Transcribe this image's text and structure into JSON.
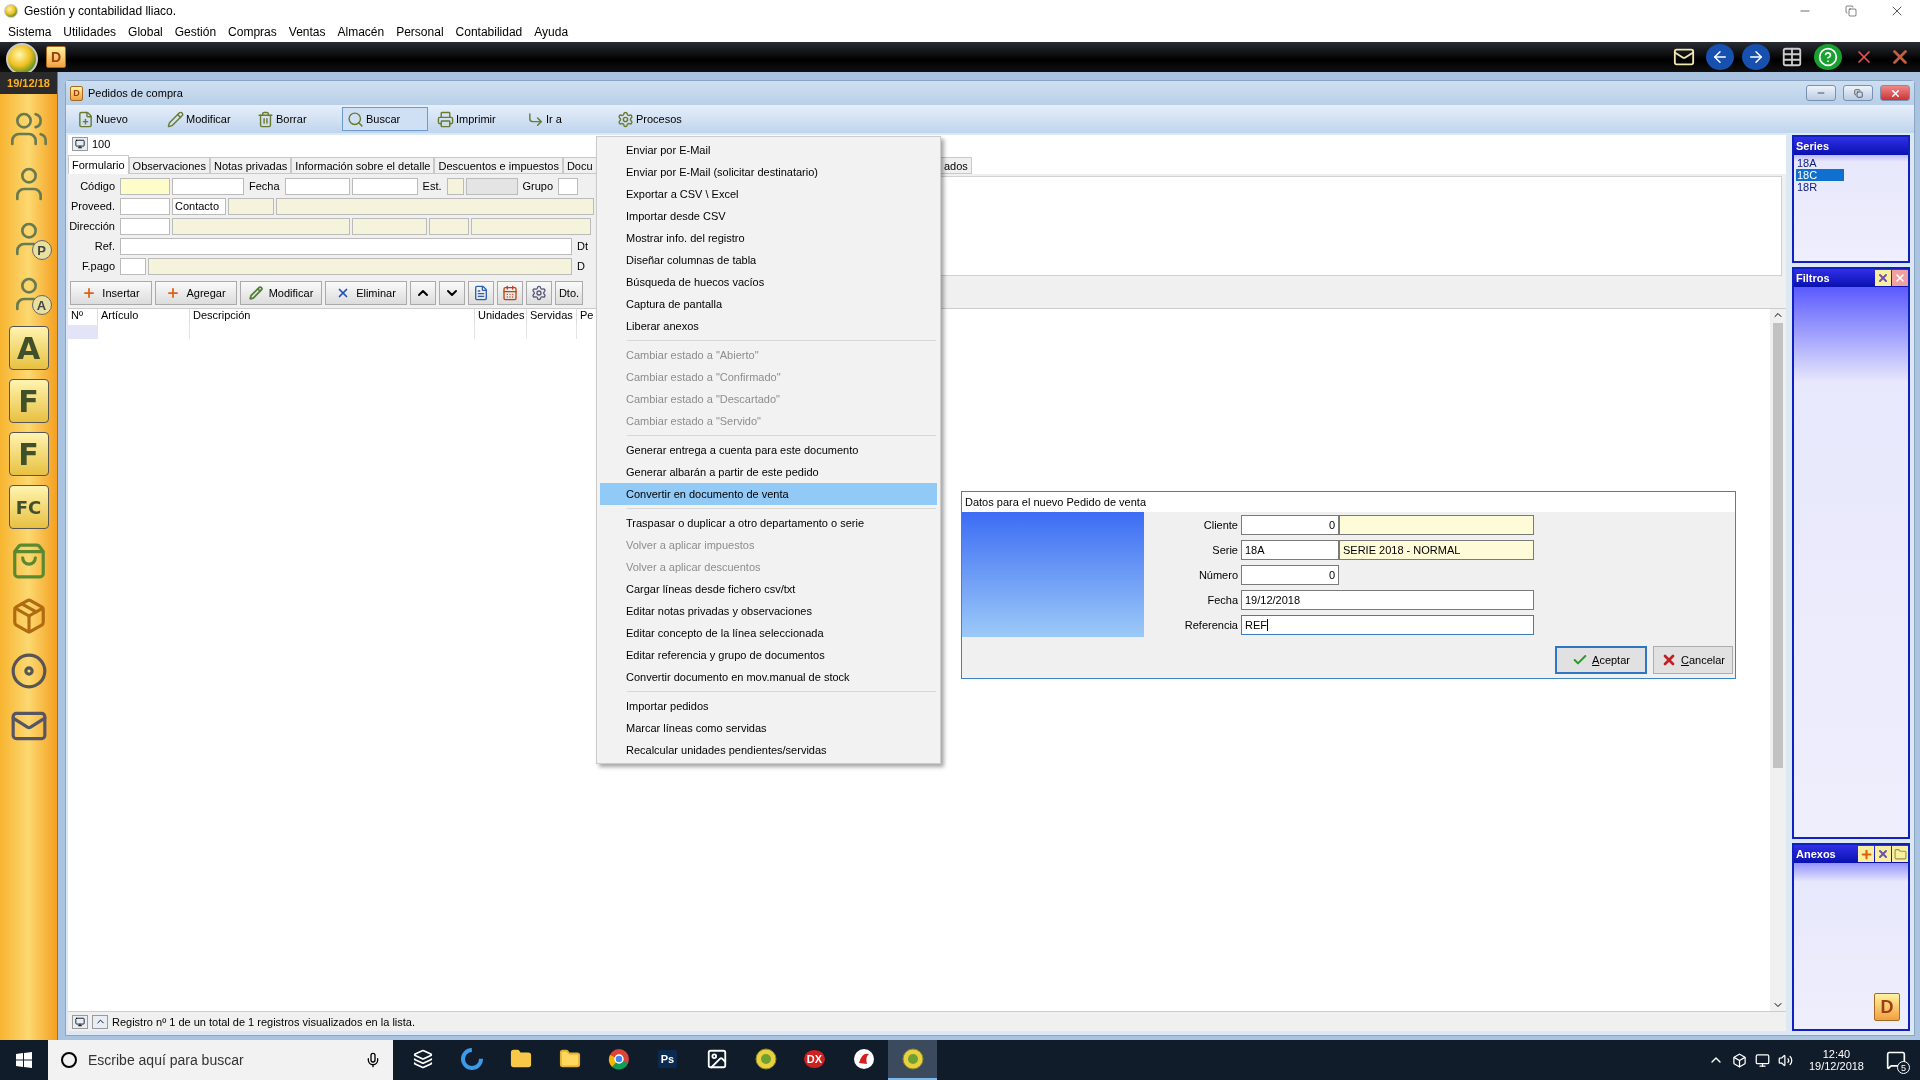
{
  "app": {
    "title": "Gestión y contabilidad lliaco."
  },
  "menu_bar": [
    "Sistema",
    "Utilidades",
    "Global",
    "Gestión",
    "Compras",
    "Ventas",
    "Almacén",
    "Personal",
    "Contabilidad",
    "Ayuda"
  ],
  "app_toolbar": {
    "logo_letter": "D"
  },
  "date": "19/12/18",
  "sidebar": [
    {
      "kind": "group"
    },
    {
      "kind": "person"
    },
    {
      "kind": "person",
      "letter": "P"
    },
    {
      "kind": "person",
      "letter": "A"
    },
    {
      "kind": "tile",
      "letter": "A"
    },
    {
      "kind": "tile",
      "letter": "F"
    },
    {
      "kind": "tile",
      "letter": "F"
    },
    {
      "kind": "tile",
      "letter": "FC"
    },
    {
      "kind": "bag"
    },
    {
      "kind": "box"
    },
    {
      "kind": "disc"
    },
    {
      "kind": "mail"
    }
  ],
  "window": {
    "title": "Pedidos de compra",
    "logo_letter": "D"
  },
  "toolbar": [
    {
      "label": "Nuevo",
      "kind": "new",
      "selected": false
    },
    {
      "label": "Modificar",
      "kind": "edit",
      "selected": false
    },
    {
      "label": "Borrar",
      "kind": "delete",
      "selected": false
    },
    {
      "label": "Buscar",
      "kind": "search",
      "selected": true
    },
    {
      "label": "Imprimir",
      "kind": "print",
      "selected": false
    },
    {
      "label": "Ir a",
      "kind": "goto",
      "selected": false
    },
    {
      "label": "Procesos",
      "kind": "process",
      "selected": false
    }
  ],
  "record": "100",
  "tabs": [
    {
      "label": "Formulario",
      "selected": true
    },
    {
      "label": "Observaciones",
      "selected": false
    },
    {
      "label": "Notas privadas",
      "selected": false
    },
    {
      "label": "Información sobre el detalle",
      "selected": false
    },
    {
      "label": "Descuentos e impuestos",
      "selected": false
    },
    {
      "label": "Docu",
      "selected": false
    }
  ],
  "tab_tail": "ados",
  "form": {
    "codigo": "Código",
    "fecha": "Fecha",
    "est": "Est.",
    "grupo": "Grupo",
    "proveed": "Proveed.",
    "contacto": "Contacto",
    "direccion": "Dirección",
    "ref": "Ref.",
    "ref_side": "Dt",
    "fpago": "F.pago",
    "fpago_side": "D"
  },
  "line_toolbar": [
    {
      "label": "Insertar",
      "kind": "insert"
    },
    {
      "label": "Agregar",
      "kind": "add"
    },
    {
      "label": "Modificar",
      "kind": "edit"
    },
    {
      "label": "Eliminar",
      "kind": "delete"
    }
  ],
  "dto": "Dto.",
  "table": {
    "columns": [
      "Nº",
      "Artículo",
      "Descripción",
      "Unidades",
      "Servidas",
      "Pe"
    ]
  },
  "context_menu": [
    [
      {
        "label": "Enviar por E-Mail",
        "disabled": false,
        "selected": false
      },
      {
        "label": "Enviar por E-Mail (solicitar destinatario)",
        "disabled": false,
        "selected": false
      },
      {
        "label": "Exportar a CSV \\ Excel",
        "disabled": false,
        "selected": false
      },
      {
        "label": "Importar desde CSV",
        "disabled": false,
        "selected": false
      },
      {
        "label": "Mostrar info. del registro",
        "disabled": false,
        "selected": false
      },
      {
        "label": "Diseñar columnas de tabla",
        "disabled": false,
        "selected": false
      },
      {
        "label": "Búsqueda de huecos vacíos",
        "disabled": false,
        "selected": false
      },
      {
        "label": "Captura de pantalla",
        "disabled": false,
        "selected": false
      },
      {
        "label": "Liberar anexos",
        "disabled": false,
        "selected": false
      }
    ],
    [
      {
        "label": "Cambiar estado a \"Abierto\"",
        "disabled": true,
        "selected": false
      },
      {
        "label": "Cambiar estado a \"Confirmado\"",
        "disabled": true,
        "selected": false
      },
      {
        "label": "Cambiar estado a \"Descartado\"",
        "disabled": true,
        "selected": false
      },
      {
        "label": "Cambiar estado a \"Servido\"",
        "disabled": true,
        "selected": false
      }
    ],
    [
      {
        "label": "Generar entrega a cuenta para este documento",
        "disabled": false,
        "selected": false
      },
      {
        "label": "Generar albarán a partir de este pedido",
        "disabled": false,
        "selected": false
      },
      {
        "label": "Convertir en documento de venta",
        "disabled": false,
        "selected": true
      }
    ],
    [
      {
        "label": "Traspasar  o duplicar a otro departamento o serie",
        "disabled": false,
        "selected": false
      },
      {
        "label": "Volver a aplicar impuestos",
        "disabled": true,
        "selected": false
      },
      {
        "label": "Volver a aplicar descuentos",
        "disabled": true,
        "selected": false
      },
      {
        "label": "Cargar líneas desde fichero csv/txt",
        "disabled": false,
        "selected": false
      },
      {
        "label": "Editar notas privadas y observaciones",
        "disabled": false,
        "selected": false
      },
      {
        "label": "Editar concepto de la línea seleccionada",
        "disabled": false,
        "selected": false
      },
      {
        "label": "Editar referencia y grupo de documentos",
        "disabled": false,
        "selected": false
      },
      {
        "label": "Convertir documento en mov.manual de stock",
        "disabled": false,
        "selected": false
      }
    ],
    [
      {
        "label": "Importar pedidos",
        "disabled": false,
        "selected": false
      },
      {
        "label": "Marcar líneas como servidas",
        "disabled": false,
        "selected": false
      },
      {
        "label": "Recalcular unidades pendientes/servidas",
        "disabled": false,
        "selected": false
      }
    ]
  ],
  "dialog": {
    "title": "Datos para el nuevo Pedido de venta",
    "fields": [
      {
        "label": "Cliente",
        "value": "0",
        "kind": "lookup-number"
      },
      {
        "label": "Serie",
        "value": "18A",
        "kind": "lookup-code",
        "description": "SERIE 2018 - NORMAL"
      },
      {
        "label": "Número",
        "value": "0",
        "kind": "number"
      },
      {
        "label": "Fecha",
        "value": "19/12/2018",
        "kind": "wide"
      },
      {
        "label": "Referencia",
        "value": "REF",
        "kind": "wide"
      }
    ],
    "buttons": [
      {
        "label": "Aceptar",
        "kind": "ok",
        "default": true
      },
      {
        "label": "Cancelar",
        "kind": "cancel",
        "default": false
      }
    ]
  },
  "series": {
    "title": "Series",
    "items": [
      {
        "label": "18A",
        "selected": false
      },
      {
        "label": "18C",
        "selected": true
      },
      {
        "label": "18R",
        "selected": false
      }
    ]
  },
  "filtros": {
    "title": "Filtros"
  },
  "anexos": {
    "title": "Anexos",
    "logo_letter": "D"
  },
  "status_bar": "Registro nº 1 de un total de 1 registros visualizados en la lista.",
  "taskbar": {
    "search_placeholder": "Escribe aquí para buscar",
    "apps": [
      {
        "kind": "taskview",
        "selected": false
      },
      {
        "kind": "edge",
        "selected": false
      },
      {
        "kind": "folder-app",
        "selected": false
      },
      {
        "kind": "explorer",
        "selected": false
      },
      {
        "kind": "chrome",
        "selected": false
      },
      {
        "kind": "text-app",
        "text": "Ps",
        "selected": false
      },
      {
        "kind": "image-app",
        "selected": false
      },
      {
        "kind": "coin-app",
        "selected": false
      },
      {
        "kind": "dx",
        "text": "DX",
        "selected": false
      },
      {
        "kind": "bird",
        "selected": false
      },
      {
        "kind": "coin-app",
        "selected": true
      }
    ],
    "time": "12:40",
    "date": "19/12/2018",
    "notifications": "5"
  }
}
